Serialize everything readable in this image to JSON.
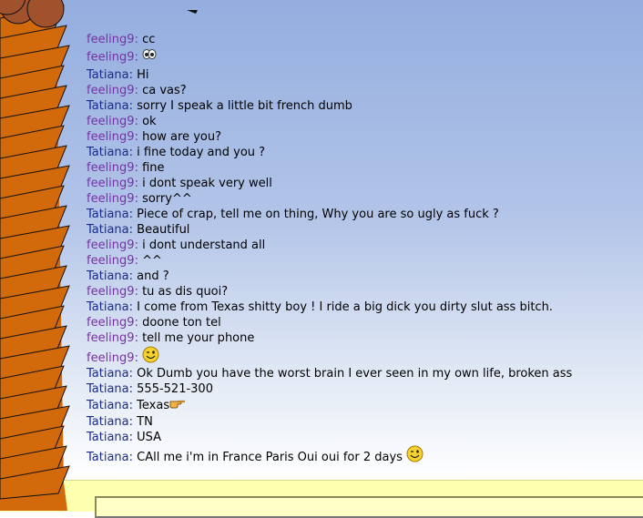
{
  "messages": [
    {
      "sender": "feeling9",
      "sep": ": ",
      "text": "cc"
    },
    {
      "sender": "feeling9",
      "sep": ": ",
      "text": "",
      "emoji": "eyes-icon"
    },
    {
      "sender": "Tatiana",
      "sep": ": ",
      "text": "Hi"
    },
    {
      "sender": "feeling9",
      "sep": ": ",
      "text": "ca vas?"
    },
    {
      "sender": "Tatiana",
      "sep": ": ",
      "text": "sorry I speak a little bit french dumb"
    },
    {
      "sender": "feeling9",
      "sep": ": ",
      "text": "ok"
    },
    {
      "sender": "feeling9",
      "sep": ": ",
      "text": "how are you?"
    },
    {
      "sender": "Tatiana",
      "sep": ": ",
      "text": "i fine today and you ?"
    },
    {
      "sender": "feeling9",
      "sep": ": ",
      "text": "fine"
    },
    {
      "sender": "feeling9",
      "sep": ": ",
      "text": "i dont speak very well"
    },
    {
      "sender": "feeling9",
      "sep": ": ",
      "text": "sorry^^"
    },
    {
      "sender": "Tatiana",
      "sep": ": ",
      "text": "Piece of crap, tell me on thing, Why you are so ugly as fuck ?"
    },
    {
      "sender": "Tatiana",
      "sep": ": ",
      "text": "Beautiful"
    },
    {
      "sender": "feeling9",
      "sep": ": ",
      "text": "i dont understand all"
    },
    {
      "sender": "feeling9",
      "sep": ": ",
      "text": "^^"
    },
    {
      "sender": "Tatiana",
      "sep": ": ",
      "text": "and ?"
    },
    {
      "sender": "feeling9",
      "sep": ": ",
      "text": "tu as dis quoi?"
    },
    {
      "sender": "Tatiana",
      "sep": ": ",
      "text": "I come from Texas shitty boy ! I ride a big dick you dirty slut ass bitch."
    },
    {
      "sender": "feeling9",
      "sep": ": ",
      "text": "doone ton tel"
    },
    {
      "sender": "feeling9",
      "sep": ": ",
      "text": "tell me your phone"
    },
    {
      "sender": "feeling9",
      "sep": ": ",
      "text": "",
      "emoji": "wink-smiley-icon"
    },
    {
      "sender": "Tatiana",
      "sep": ": ",
      "text": "Ok Dumb you have the worst brain I ever seen in my own life, broken ass"
    },
    {
      "sender": "Tatiana",
      "sep": ": ",
      "text": "555-521-300"
    },
    {
      "sender": "Tatiana",
      "sep": ": ",
      "text": "Texas",
      "emoji": "pointing-hand-icon"
    },
    {
      "sender": "Tatiana",
      "sep": ": ",
      "text": "TN"
    },
    {
      "sender": "Tatiana",
      "sep": ": ",
      "text": "USA"
    },
    {
      "sender": "Tatiana",
      "sep": ": ",
      "text": "CAll me i'm in France Paris Oui oui for 2 days",
      "emoji": "wink-smiley-icon"
    }
  ],
  "colors": {
    "feeling9": "#7a2fa8",
    "Tatiana": "#1a2b8c",
    "background_top": "#94aedf",
    "background_bottom": "#ffffff",
    "input_strip": "#ffffb0",
    "art_orange": "#d2690a",
    "art_brown": "#a0522d"
  },
  "input": {
    "value": ""
  }
}
